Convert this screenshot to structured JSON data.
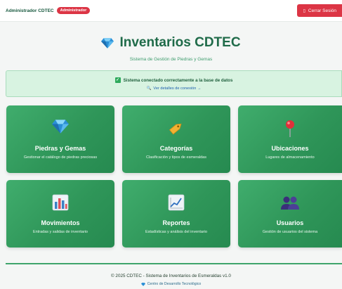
{
  "header": {
    "user_name": "Administrador CDTEC",
    "role_badge": "Administrador",
    "logout_label": "Cerrar Sesión"
  },
  "hero": {
    "title": "Inventarios CDTEC",
    "subtitle": "Sistema de Gestión de Piedras y Gemas",
    "icon": "gem-icon"
  },
  "status": {
    "message": "Sistema conectado correctamente a la base de datos",
    "details_link": "Ver detalles de conexión →"
  },
  "cards": [
    {
      "title": "Piedras y Gemas",
      "description": "Gestionar el catálogo de piedras preciosas",
      "icon": "gem-icon"
    },
    {
      "title": "Categorías",
      "description": "Clasificación y tipos de esmeraldas",
      "icon": "tag-icon"
    },
    {
      "title": "Ubicaciones",
      "description": "Lugares de almacenamiento",
      "icon": "pin-icon"
    },
    {
      "title": "Movimientos",
      "description": "Entradas y salidas de inventario",
      "icon": "bar-chart-icon"
    },
    {
      "title": "Reportes",
      "description": "Estadísticas y análisis del inventario",
      "icon": "line-chart-icon"
    },
    {
      "title": "Usuarios",
      "description": "Gestión de usuarios del sistema",
      "icon": "users-icon"
    }
  ],
  "footer": {
    "copyright": "© 2025 CDTEC - Sistema de Inventarios de Esmeraldas v1.0",
    "center": "Centro de Desarrollo Tecnológico"
  },
  "colors": {
    "brand_green": "#2f9659",
    "danger_red": "#dc3545",
    "status_bg": "#d8f3e1"
  }
}
